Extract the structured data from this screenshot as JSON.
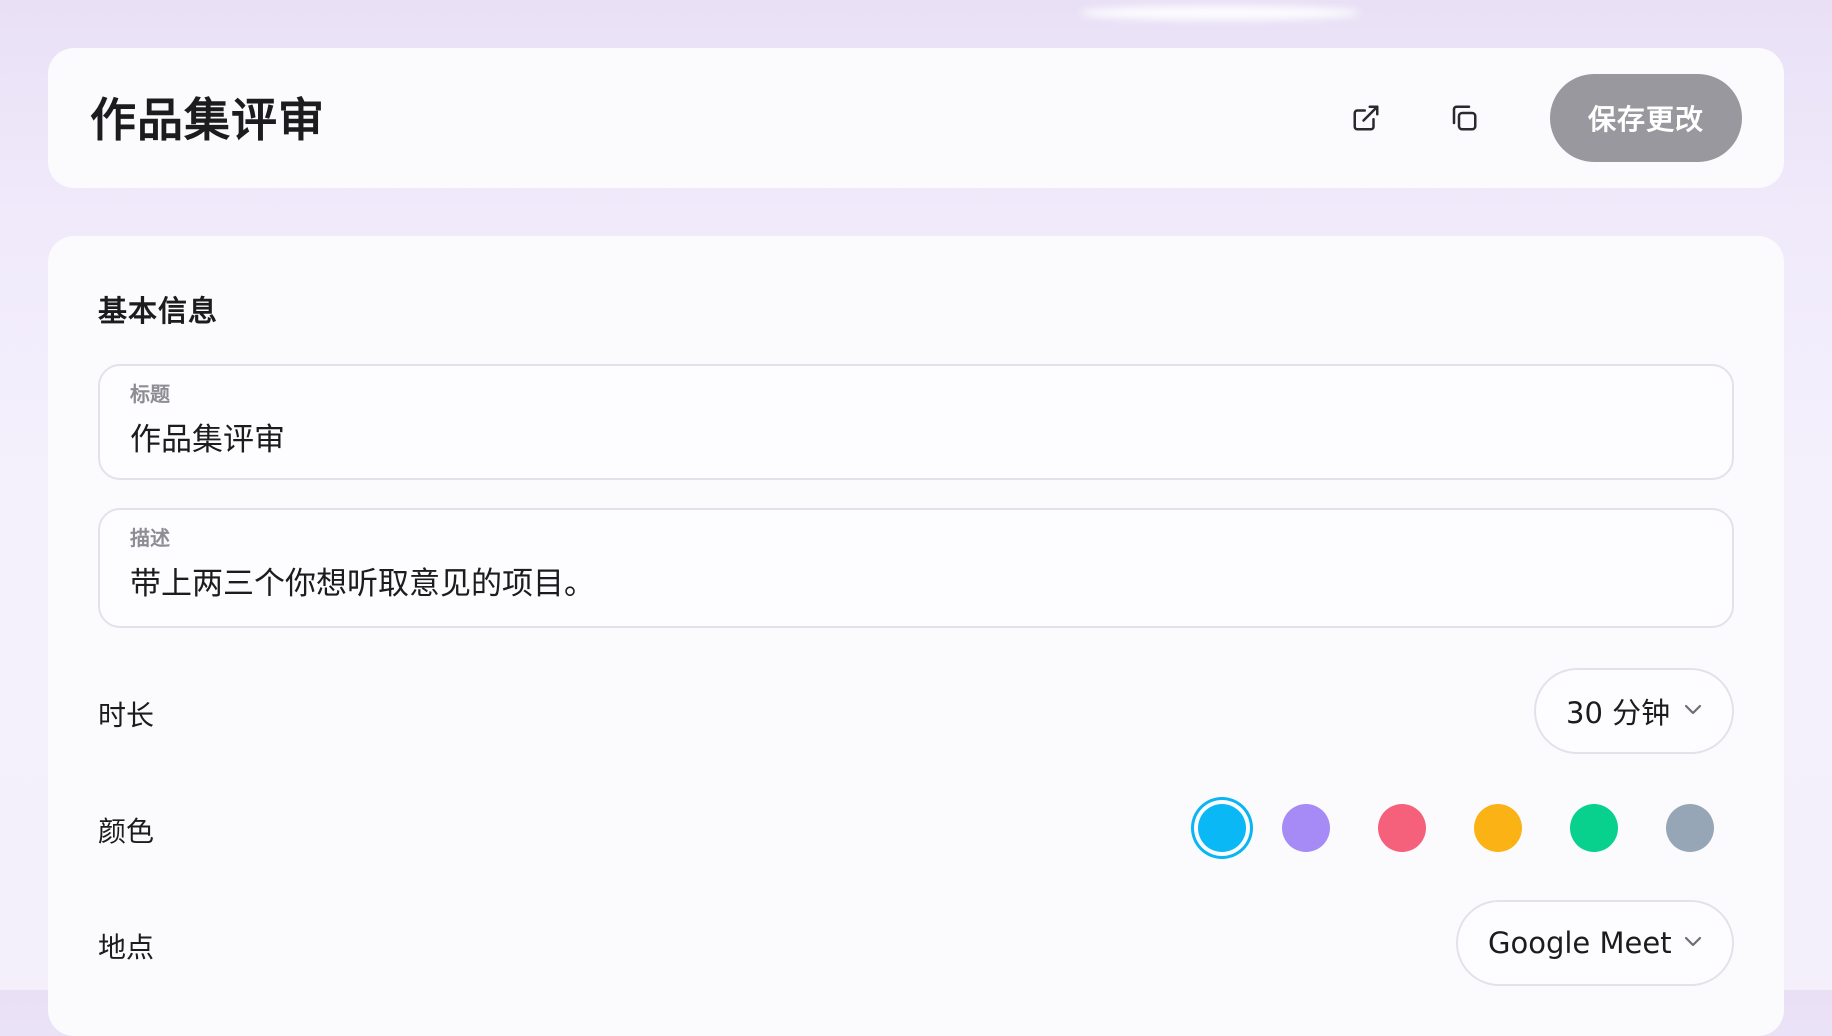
{
  "header": {
    "title": "作品集评审",
    "save_label": "保存更改",
    "icons": [
      "external-link-icon",
      "copy-icon"
    ]
  },
  "basic_info": {
    "section_title": "基本信息",
    "title_field": {
      "label": "标题",
      "value": "作品集评审"
    },
    "description_field": {
      "label": "描述",
      "value": "带上两三个你想听取意见的项目。"
    },
    "duration": {
      "label": "时长",
      "value": "30 分钟"
    },
    "color": {
      "label": "颜色",
      "selected": "#0ab8f5",
      "options": [
        "#0ab8f5",
        "#a68af5",
        "#f5607a",
        "#fbb214",
        "#07d18d",
        "#96a6b6"
      ]
    },
    "location": {
      "label": "地点",
      "value": "Google Meet"
    }
  }
}
